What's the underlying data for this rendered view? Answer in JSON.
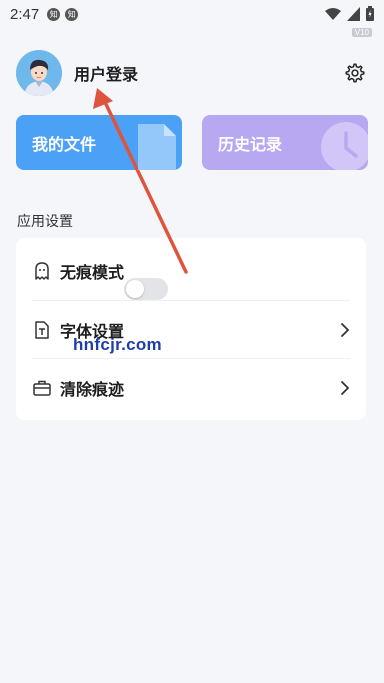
{
  "status_bar": {
    "time": "2:47",
    "notification_icons": [
      "知",
      "知"
    ],
    "version_badge": "V10"
  },
  "profile": {
    "login_label": "用户登录"
  },
  "quick_cards": {
    "files_label": "我的文件",
    "history_label": "历史记录"
  },
  "app_settings": {
    "section_title": "应用设置",
    "rows": [
      {
        "label": "无痕模式",
        "icon": "ghost-icon",
        "control": "toggle",
        "enabled": false
      },
      {
        "label": "字体设置",
        "icon": "font-file-icon",
        "control": "chevron"
      },
      {
        "label": "清除痕迹",
        "icon": "briefcase-icon",
        "control": "chevron"
      }
    ]
  },
  "watermark": "hnfcjr.com",
  "colors": {
    "files_card": "#4ba1f6",
    "history_card": "#b8a8f2",
    "annotation_arrow": "#e0533d"
  }
}
